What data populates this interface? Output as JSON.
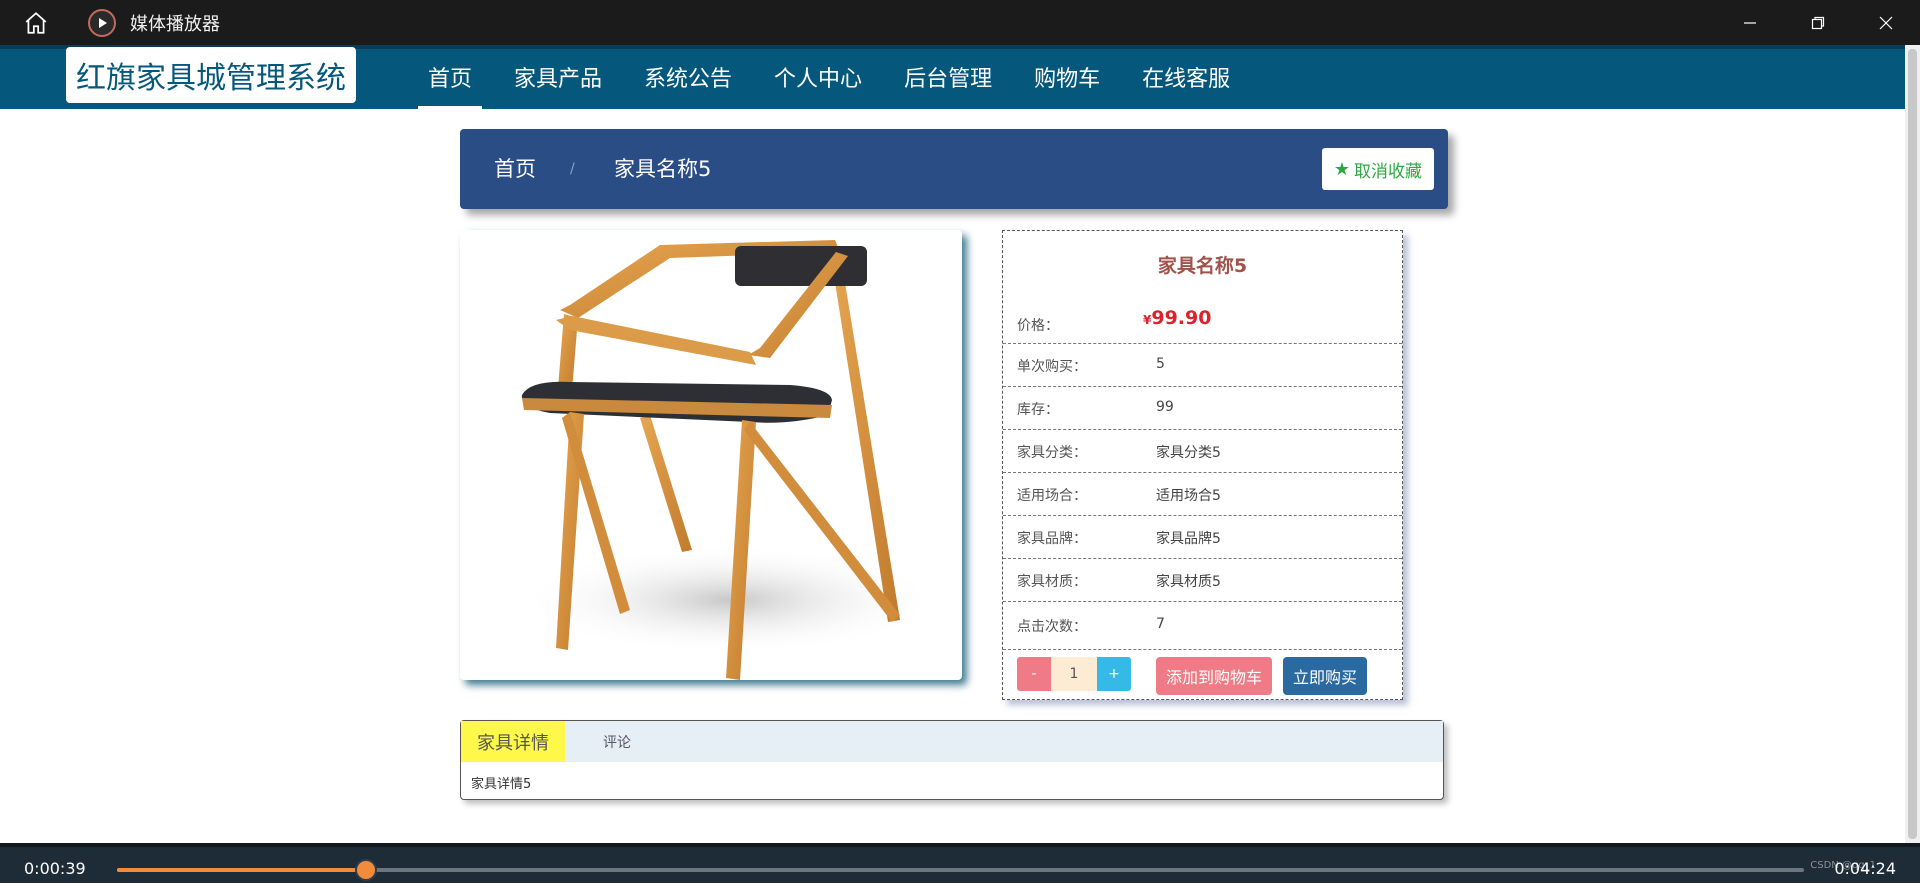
{
  "window": {
    "title": "媒体播放器"
  },
  "site": {
    "logo": "红旗家具城管理系统",
    "nav": [
      {
        "label": "首页",
        "active": true
      },
      {
        "label": "家具产品",
        "active": false
      },
      {
        "label": "系统公告",
        "active": false
      },
      {
        "label": "个人中心",
        "active": false
      },
      {
        "label": "后台管理",
        "active": false
      },
      {
        "label": "购物车",
        "active": false
      },
      {
        "label": "在线客服",
        "active": false
      }
    ]
  },
  "breadcrumb": {
    "home": "首页",
    "separator": "/",
    "current": "家具名称5",
    "favorite_label": "取消收藏"
  },
  "product": {
    "name": "家具名称5",
    "price_label": "价格：",
    "currency": "¥",
    "price": "99.90",
    "attributes": [
      {
        "label": "单次购买：",
        "value": "5"
      },
      {
        "label": "库存：",
        "value": "99"
      },
      {
        "label": "家具分类：",
        "value": "家具分类5"
      },
      {
        "label": "适用场合：",
        "value": "适用场合5"
      },
      {
        "label": "家具品牌：",
        "value": "家具品牌5"
      },
      {
        "label": "家具材质：",
        "value": "家具材质5"
      },
      {
        "label": "点击次数：",
        "value": "7"
      }
    ],
    "quantity": "1",
    "minus_label": "-",
    "plus_label": "+",
    "add_to_cart": "添加到购物车",
    "buy_now": "立即购买"
  },
  "tabs": {
    "details": "家具详情",
    "comments": "评论",
    "content": "家具详情5"
  },
  "player": {
    "current_time": "0:00:39",
    "total_time": "0:04:24",
    "progress": 0.1477,
    "watermark": "CSDN @qq_1"
  },
  "colors": {
    "header": "#05587c",
    "breadcrumb": "#2a4d86",
    "price": "#d9232d",
    "accent_orange": "#f28b3c"
  }
}
